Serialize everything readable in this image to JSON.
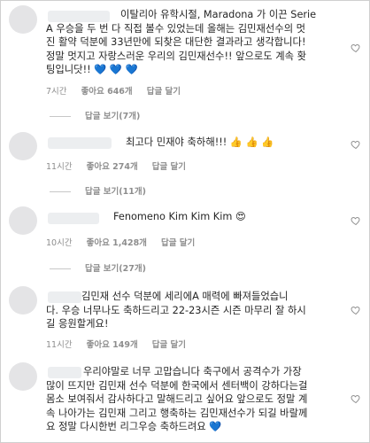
{
  "comments": [
    {
      "text_lines": [
        "이탈리아 유학시절, Maradona 가 이끈 Serie",
        "A 우승을 두 번 다 직접 볼수 있었는데 올해는 김민재선수의 멋",
        "진 활약 덕분에 33년만에 되찾은 대단한 결과라고 생각합니다!",
        "정말 멋지고 자랑스러운 우리의 김민재선수!! 앞으로도 계속 홧",
        "팅입니닷!! 💙 💙 💙"
      ],
      "time": "7시간",
      "likes": "좋아요 646개",
      "reply": "답글 달기",
      "view_replies": "답글 보기(7개)"
    },
    {
      "text_lines": [
        "최고다 민재야 축하해!!! 👍 👍 👍"
      ],
      "time": "11시간",
      "likes": "좋아요 274개",
      "reply": "답글 달기",
      "view_replies": "답글 보기(11개)"
    },
    {
      "text_lines": [
        "Fenomeno Kim Kim Kim 😍"
      ],
      "time": "10시간",
      "likes": "좋아요 1,428개",
      "reply": "답글 달기",
      "view_replies": "답글 보기(27개)"
    },
    {
      "text_lines": [
        "김민재 선수 덕분에 세리에A 매력에 빠져들었습니",
        "다. 우승 너무나도 축하드리고 22-23시즌 시즌 마무리 잘 하시",
        "길 응원할게요!"
      ],
      "time": "11시간",
      "likes": "좋아요 149개",
      "reply": "답글 달기"
    },
    {
      "text_lines": [
        "우리야말로 너무 고맙습니다 축구에서 공격수가 가장",
        "많이 뜨지만 김민재 선수 덕분에 한국에서 센터백이 강하다는걸",
        "몸소 보여줘서 감사하다고 말해드리고 싶어요 앞으로도 정말 계",
        "속 나아가는 김민재 그리고 행축하는 김민재선수가 되길 바랄께",
        "요 정말 다시한번 리그우승 축하드려요 💙"
      ]
    }
  ],
  "colors": {
    "text": "#262626",
    "muted": "#8e8e8e",
    "heart": "#8e8e8e"
  },
  "icons": {
    "heart": "heart-outline-icon"
  }
}
